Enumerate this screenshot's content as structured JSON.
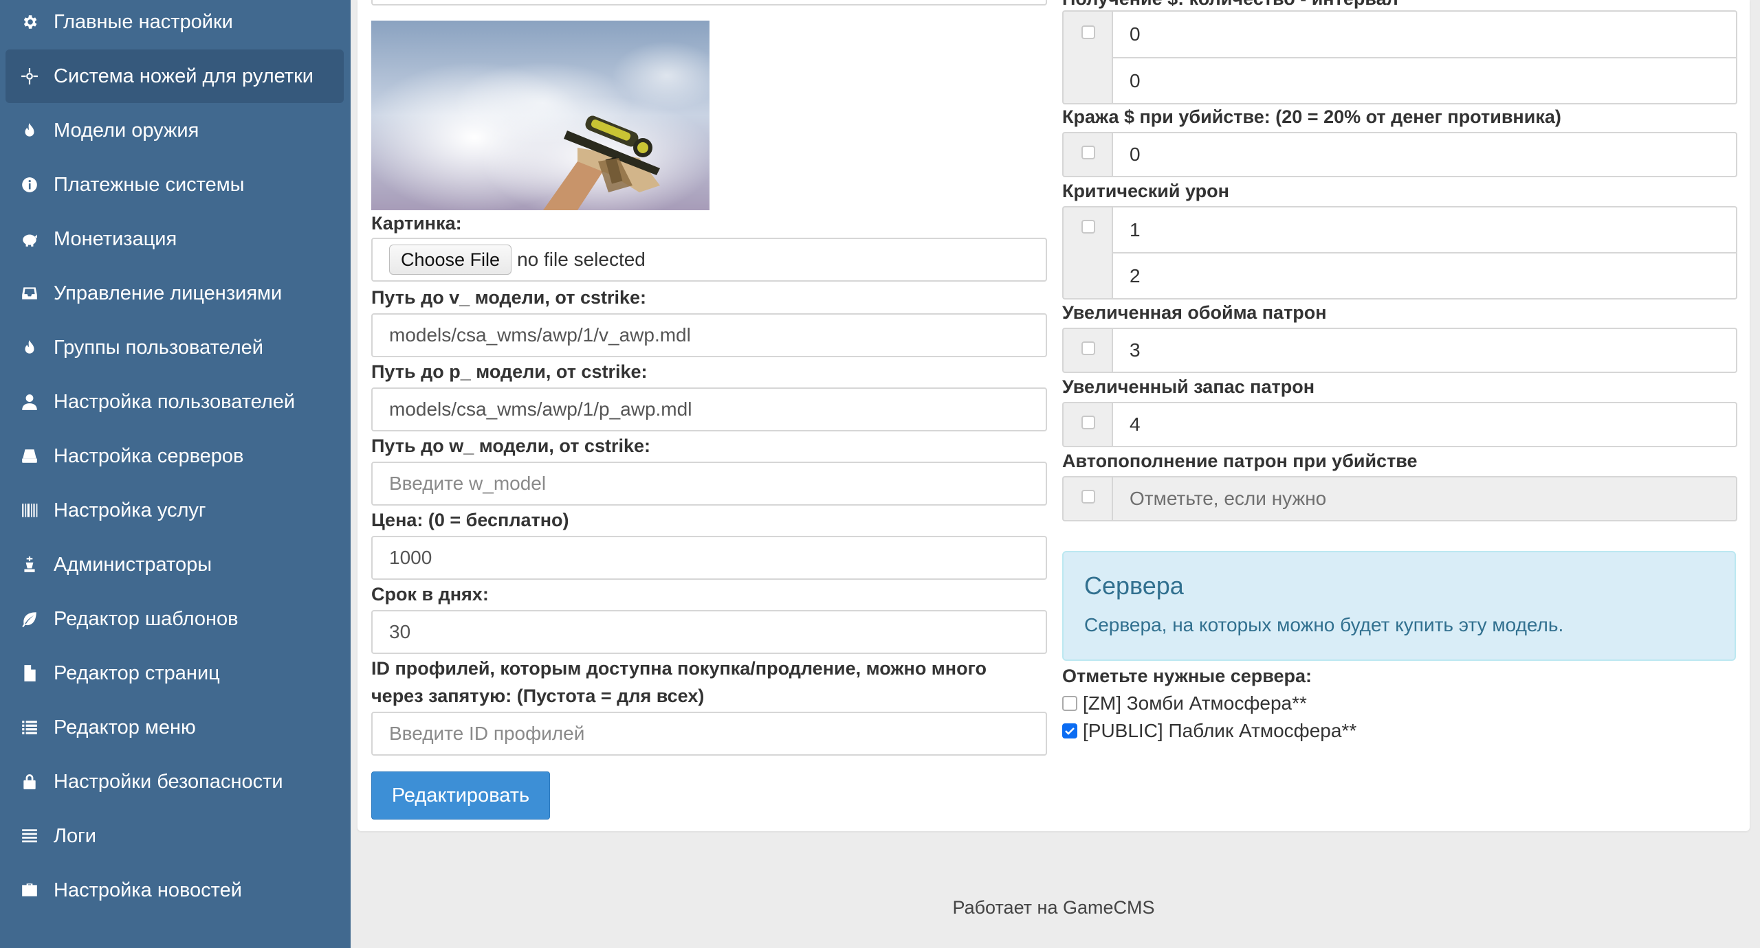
{
  "sidebar": {
    "items": [
      {
        "label": "Главные настройки",
        "icon": "gear-icon"
      },
      {
        "label": "Система ножей для рулетки",
        "icon": "crosshair-icon",
        "active": true
      },
      {
        "label": "Модели оружия",
        "icon": "fire-icon"
      },
      {
        "label": "Платежные системы",
        "icon": "info-icon"
      },
      {
        "label": "Монетизация",
        "icon": "piggy-bank-icon"
      },
      {
        "label": "Управление лицензиями",
        "icon": "inbox-icon"
      },
      {
        "label": "Группы пользователей",
        "icon": "fire-icon"
      },
      {
        "label": "Настройка пользователей",
        "icon": "user-icon"
      },
      {
        "label": "Настройка серверов",
        "icon": "hdd-icon"
      },
      {
        "label": "Настройка услуг",
        "icon": "barcode-icon"
      },
      {
        "label": "Администраторы",
        "icon": "chess-king-icon"
      },
      {
        "label": "Редактор шаблонов",
        "icon": "leaf-icon"
      },
      {
        "label": "Редактор страниц",
        "icon": "file-icon"
      },
      {
        "label": "Редактор меню",
        "icon": "list-icon"
      },
      {
        "label": "Настройки безопасности",
        "icon": "lock-icon"
      },
      {
        "label": "Логи",
        "icon": "align-justify-icon"
      },
      {
        "label": "Настройка новостей",
        "icon": "briefcase-icon"
      }
    ]
  },
  "form": {
    "image_label": "Картинка:",
    "file_button": "Choose File",
    "file_status": "no file selected",
    "v_model_label": "Путь до v_ модели, от cstrike:",
    "v_model_value": "models/csa_wms/awp/1/v_awp.mdl",
    "p_model_label": "Путь до p_ модели, от cstrike:",
    "p_model_value": "models/csa_wms/awp/1/p_awp.mdl",
    "w_model_label": "Путь до w_ модели, от cstrike:",
    "w_model_placeholder": "Введите w_model",
    "price_label": "Цена: (0 = бесплатно)",
    "price_value": "1000",
    "days_label": "Срок в днях:",
    "days_value": "30",
    "profiles_label_line1": "ID профилей, которым доступна покупка/продление, можно много",
    "profiles_label_line2": "через запятую: (Пустота = для всех)",
    "profiles_placeholder": "Введите ID профилей",
    "submit_label": "Редактировать"
  },
  "right": {
    "money_label": "Получение $: количество - интервал",
    "money_amount": "0",
    "money_interval": "0",
    "steal_label": "Кража $ при убийстве: (20 = 20% от денег противника)",
    "steal_value": "0",
    "crit_label": "Критический урон",
    "crit_value1": "1",
    "crit_value2": "2",
    "clip_label": "Увеличенная обойма патрон",
    "clip_value": "3",
    "ammo_label": "Увеличенный запас патрон",
    "ammo_value": "4",
    "autorefill_label": "Автопополнение патрон при убийстве",
    "autorefill_placeholder": "Отметьте, если нужно",
    "servers_title": "Сервера",
    "servers_desc": "Сервера, на которых можно будет купить эту модель.",
    "servers_select_label": "Отметьте нужные сервера:",
    "servers": [
      {
        "name": "[ZM] Зомби Атмосфера**",
        "checked": false
      },
      {
        "name": "[PUBLIC] Паблик Атмосфера**",
        "checked": true
      }
    ]
  },
  "footer": {
    "text": "Работает на GameCMS"
  }
}
